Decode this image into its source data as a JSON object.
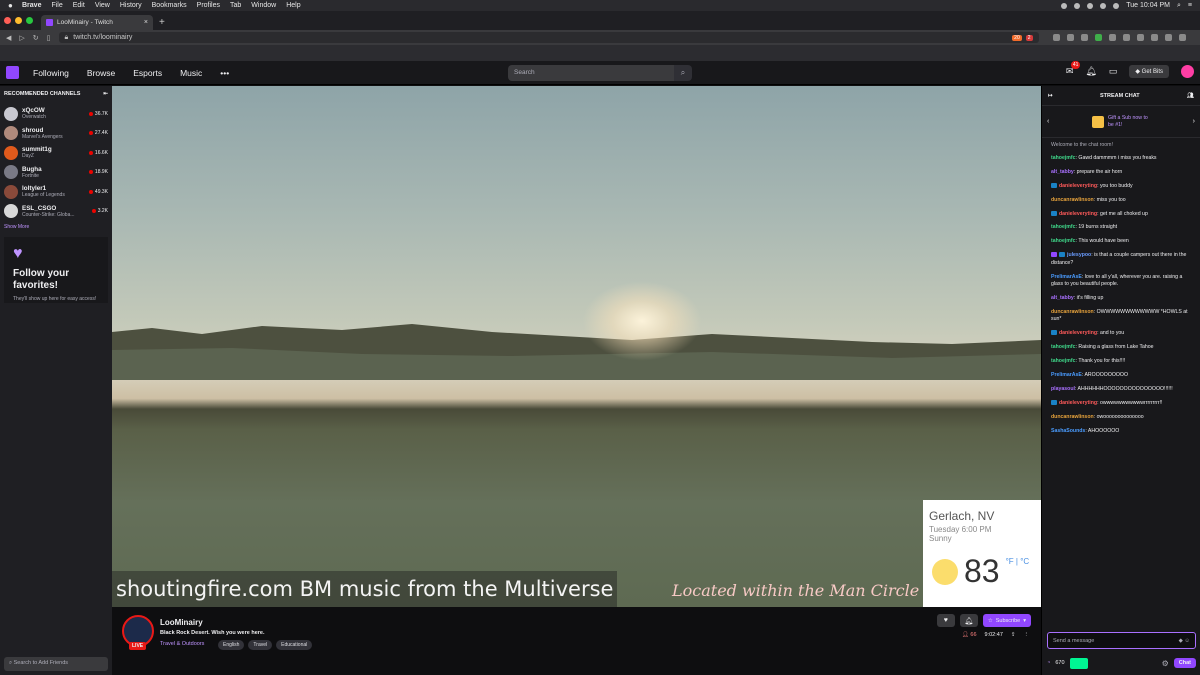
{
  "macbar": {
    "app": "Brave",
    "menus": [
      "File",
      "Edit",
      "View",
      "History",
      "Bookmarks",
      "Profiles",
      "Tab",
      "Window",
      "Help"
    ],
    "clock": "Tue 10:04 PM"
  },
  "browser": {
    "tab_title": "LooMinairy - Twitch",
    "url": "twitch.tv/loominairy",
    "ext_badge_1": "20",
    "ext_badge_2": "2"
  },
  "nav": {
    "links": [
      "Following",
      "Browse",
      "Esports",
      "Music"
    ],
    "more": "•••",
    "search_placeholder": "Search",
    "inbox_count": "41",
    "get_bits": "Get Bits"
  },
  "sidebar": {
    "header": "RECOMMENDED CHANNELS",
    "channels": [
      {
        "name": "xQcOW",
        "game": "Overwatch",
        "viewers": "36.7K",
        "color": "#c8c8d0"
      },
      {
        "name": "shroud",
        "game": "Marvel's Avengers",
        "viewers": "27.4K",
        "color": "#b08a7c"
      },
      {
        "name": "summit1g",
        "game": "DayZ",
        "viewers": "16.6K",
        "color": "#e05a1c"
      },
      {
        "name": "Bugha",
        "game": "Fortnite",
        "viewers": "18.9K",
        "color": "#7a7a86"
      },
      {
        "name": "loltyler1",
        "game": "League of Legends",
        "viewers": "49.3K",
        "color": "#8a4a3a"
      },
      {
        "name": "ESL_CSGO",
        "game": "Counter-Strike: Globa...",
        "viewers": "3.2K",
        "color": "#d8d8d8"
      }
    ],
    "show_more": "Show More",
    "fav_title": "Follow your favorites!",
    "fav_sub": "They'll show up here for easy access!",
    "search_friends": "Search to Add Friends"
  },
  "player": {
    "overlay_left": "shoutingfire.com BM music from the Multiverse",
    "overlay_right": "Located within the Man Circle",
    "weather": {
      "city": "Gerlach, NV",
      "date": "Tuesday 6:00 PM",
      "condition": "Sunny",
      "temp": "83",
      "units": "°F | °C"
    }
  },
  "stream": {
    "name": "LooMinairy",
    "live": "LIVE",
    "title": "Black Rock Desert. Wish you were here.",
    "category": "Travel & Outdoors",
    "tags": [
      "English",
      "Travel",
      "Educational"
    ],
    "subscribe": "Subscribe",
    "viewers": "66",
    "uptime": "9:02:47"
  },
  "chat": {
    "header": "STREAM CHAT",
    "gift_text": "Gift a Sub now to be #1!",
    "welcome": "Welcome to the chat room!",
    "messages": [
      {
        "user": "tahoejmfc",
        "color": "#3fd88a",
        "text": "Gawd dammmm i miss you freaks",
        "badge": ""
      },
      {
        "user": "alt_tabby",
        "color": "#a970ff",
        "text": "prepare the air horn",
        "badge": ""
      },
      {
        "user": "danieleveryting",
        "color": "#ff5a5a",
        "text": "you too buddy",
        "badge": "b"
      },
      {
        "user": "duncanrawlinson",
        "color": "#e6a23c",
        "text": "miss you too",
        "badge": ""
      },
      {
        "user": "danieleveryting",
        "color": "#ff5a5a",
        "text": "get me all choked up",
        "badge": "b"
      },
      {
        "user": "tahoejmfc",
        "color": "#3fd88a",
        "text": "19 burns straight",
        "badge": ""
      },
      {
        "user": "tahoejmfc",
        "color": "#3fd88a",
        "text": "This would have been",
        "badge": ""
      },
      {
        "user": "julesypoo",
        "color": "#6a9cff",
        "text": "is that a couple campers out there in the distance?",
        "badge": "pb"
      },
      {
        "user": "PrelimarAsE",
        "color": "#4a9cff",
        "text": "love to all y'all, wherever you are. raising a glass to you beautiful people.",
        "badge": ""
      },
      {
        "user": "alt_tabby",
        "color": "#a970ff",
        "text": "it's filling up",
        "badge": ""
      },
      {
        "user": "duncanrawlinson",
        "color": "#e6a23c",
        "text": "OWWWWWWWWWWWW *HOWLS at sun*",
        "badge": ""
      },
      {
        "user": "danieleveryting",
        "color": "#ff5a5a",
        "text": "and to you",
        "badge": "b"
      },
      {
        "user": "tahoejmfc",
        "color": "#3fd88a",
        "text": "Raising a glass from Lake Tahoe",
        "badge": ""
      },
      {
        "user": "tahoejmfc",
        "color": "#3fd88a",
        "text": "Thank you for this!!!!",
        "badge": ""
      },
      {
        "user": "PrelimarAsE",
        "color": "#4a9cff",
        "text": "AROOOOOOOOO",
        "badge": ""
      },
      {
        "user": "playasoul",
        "color": "#a970ff",
        "text": "AHHHHHHOOOOOOOOOOOOOOO!!!!!!",
        "badge": ""
      },
      {
        "user": "danieleveryting",
        "color": "#ff5a5a",
        "text": "owwwwwwwwwwwrrrrrrrrr!!",
        "badge": "b"
      },
      {
        "user": "duncanrawlinson",
        "color": "#e6a23c",
        "text": "owoooooooooooooo",
        "badge": ""
      },
      {
        "user": "SashaSounds",
        "color": "#4a9cff",
        "text": "AHOOOOOO",
        "badge": ""
      }
    ],
    "input_placeholder": "Send a message",
    "points": "670",
    "chat_button": "Chat"
  }
}
